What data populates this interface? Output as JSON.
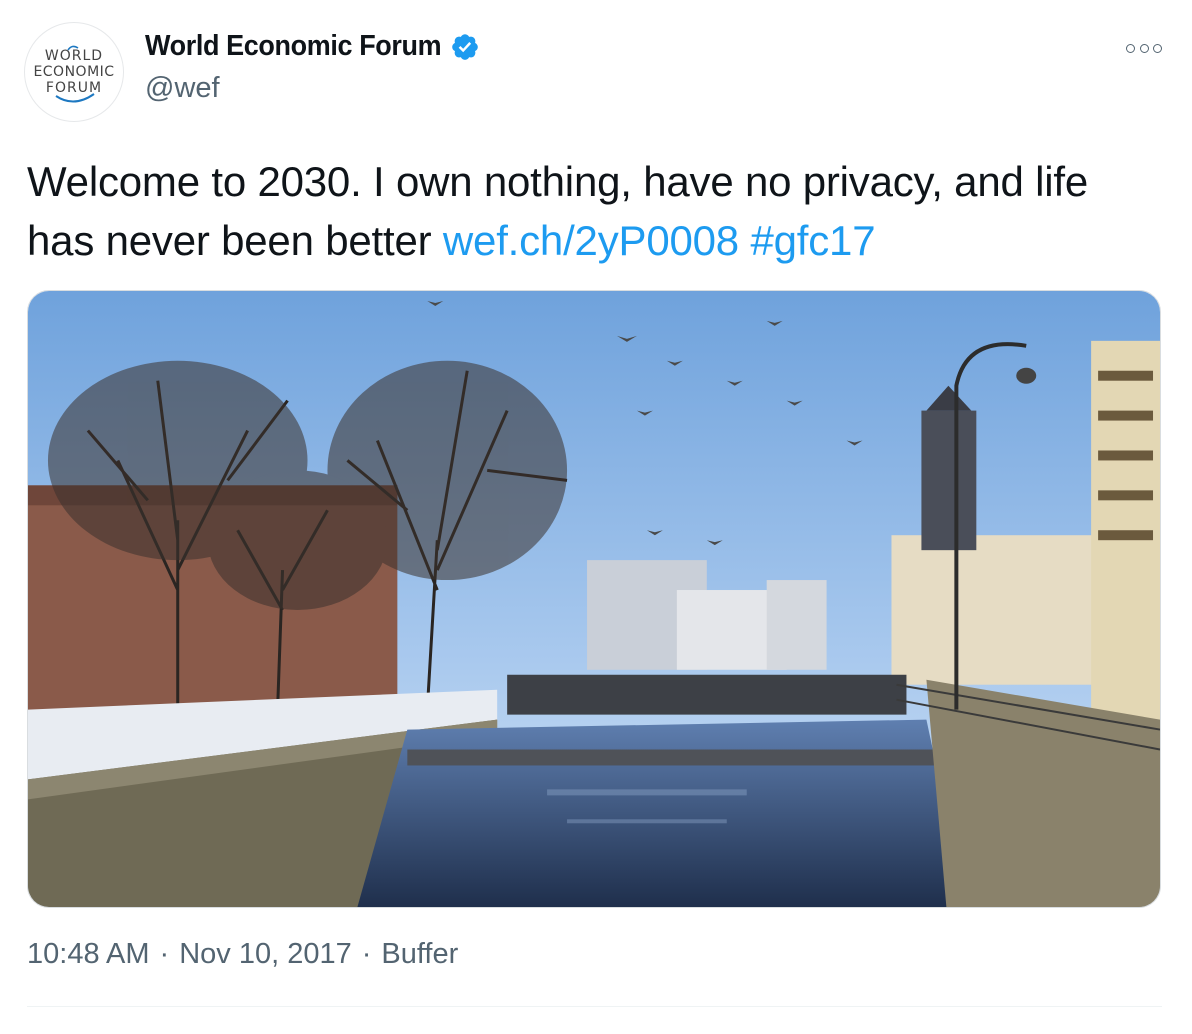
{
  "account": {
    "avatar_logo_lines": [
      "WORLD",
      "ECONOMIC",
      "FORUM"
    ],
    "display_name": "World Economic Forum",
    "handle": "@wef",
    "verified": true,
    "verified_icon": "verified-badge-icon",
    "verified_color": "#1d9bf0"
  },
  "more_icon": "more-options-icon",
  "tweet": {
    "text": "Welcome to 2030. I own nothing, have no privacy, and life has never been better",
    "link_text": "wef.ch/2yP0008",
    "hashtag": "#gfc17",
    "link_color": "#1d9bf0"
  },
  "media": {
    "type": "photo",
    "icon": "canal-city-photo"
  },
  "meta": {
    "time": "10:48 AM",
    "separator": "·",
    "date": "Nov 10, 2017",
    "source": "Buffer"
  }
}
